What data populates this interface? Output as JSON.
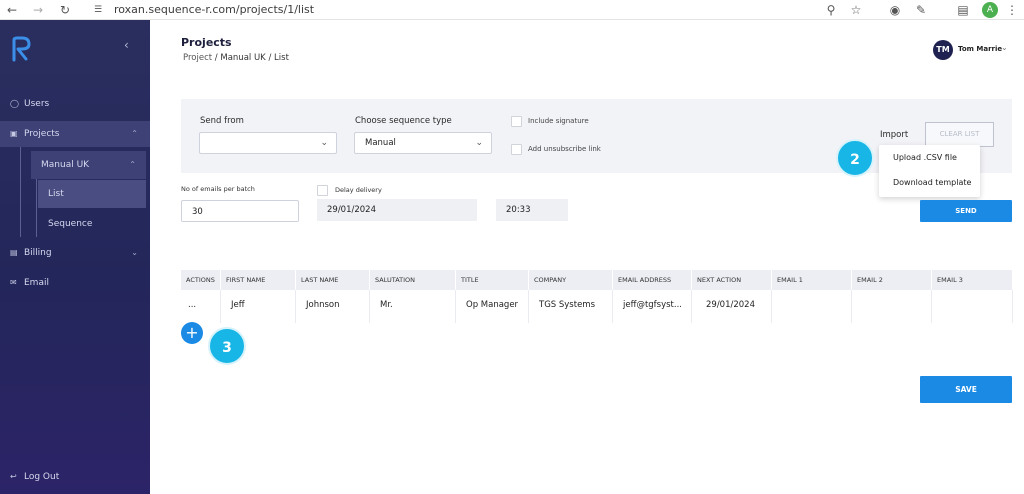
{
  "browser": {
    "url": "roxan.sequence-r.com/projects/1/list",
    "profile_initial": "A",
    "profile_color": "#4caf50"
  },
  "sidebar": {
    "items": [
      {
        "label": "Users",
        "icon": "user-icon"
      },
      {
        "label": "Projects",
        "icon": "folder-icon"
      },
      {
        "label": "Billing",
        "icon": "billing-icon"
      },
      {
        "label": "Email",
        "icon": "mail-icon"
      }
    ],
    "project_item": "Manual UK",
    "sub_items": [
      "List",
      "Sequence"
    ],
    "logout": "Log Out",
    "bg_color": "#2b2f5f"
  },
  "header": {
    "title": "Projects",
    "breadcrumb": [
      "Project",
      "Manual UK",
      "List"
    ],
    "user_initials": "TM",
    "user_name": "Tom Marrie"
  },
  "form": {
    "send_from_label": "Send from",
    "send_from_value": "",
    "sequence_type_label": "Choose sequence type",
    "sequence_type_value": "Manual",
    "include_signature": "Include signature",
    "add_unsubscribe": "Add unsubscribe link",
    "import_label": "Import",
    "clear_list": "CLEAR LIST",
    "import_menu": [
      "Upload .CSV file",
      "Download template"
    ]
  },
  "batch": {
    "emails_per_batch_label": "No of emails per batch",
    "emails_per_batch_value": "30",
    "delay_label": "Delay delivery",
    "date": "29/01/2024",
    "time": "20:33",
    "send": "SEND"
  },
  "table": {
    "columns": [
      "ACTIONS",
      "FIRST NAME",
      "LAST NAME",
      "SALUTATION",
      "TITLE",
      "COMPANY",
      "EMAIL ADDRESS",
      "NEXT ACTION",
      "EMAIL 1",
      "EMAIL 2",
      "EMAIL 3"
    ],
    "rows": [
      [
        "...",
        "Jeff",
        "Johnson",
        "Mr.",
        "Op Manager",
        "TGS Systems",
        "jeff@tgfsyst...",
        "29/01/2024",
        "",
        "",
        ""
      ]
    ]
  },
  "markers": [
    "2",
    "3"
  ],
  "save": "SAVE",
  "accent_color": "#1a8ae5",
  "marker_color": "#17b6e6"
}
